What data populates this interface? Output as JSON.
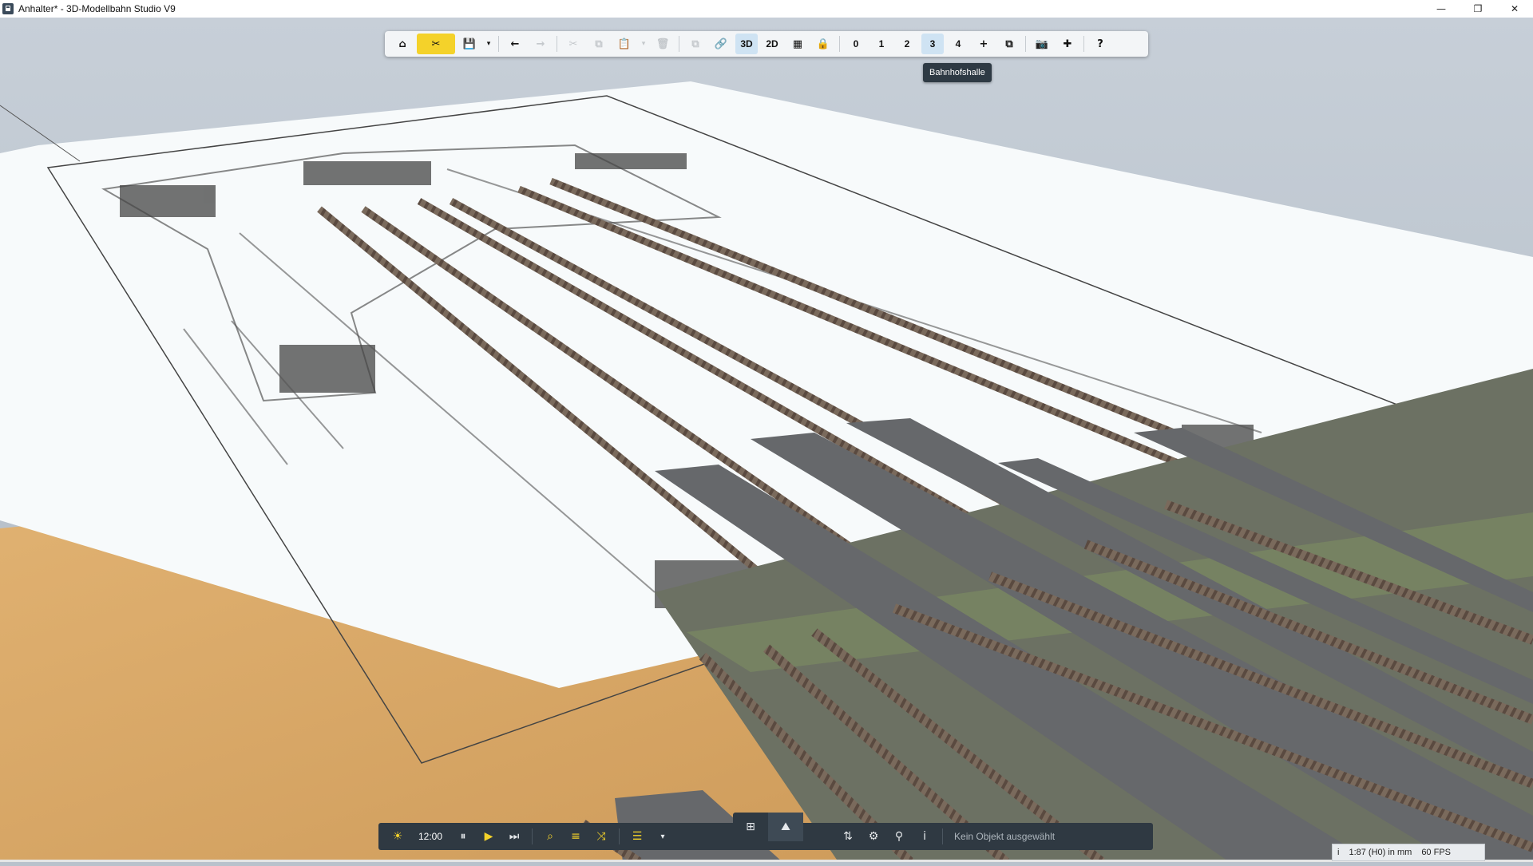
{
  "window": {
    "title": "Anhalter* - 3D-Modellbahn Studio V9",
    "minimize": "—",
    "restore": "❐",
    "close": "✕"
  },
  "toolbar": {
    "home": "⌂",
    "tools": "✂",
    "save": "💾",
    "save_dropdown": "▾",
    "undo": "←",
    "redo": "→",
    "cut": "✂",
    "copy": "⧉",
    "paste": "📋",
    "paste_dropdown": "▾",
    "delete": "🗑",
    "duplicate": "⧉",
    "link": "🔗",
    "view_3d": "3D",
    "view_2d": "2D",
    "grid": "▦",
    "lock": "🔒",
    "layers": [
      "0",
      "1",
      "2",
      "3",
      "4"
    ],
    "add": "+",
    "window": "⧉",
    "camera": "📷",
    "plugins": "✚",
    "help": "?"
  },
  "tooltip": {
    "text": "Bahnhofshalle"
  },
  "bottom": {
    "sun": "☀",
    "time": "12:00",
    "pause": "⏸",
    "play": "▶",
    "next": "⏭",
    "search": "⌕",
    "layers": "≡",
    "shuffle": "⤨",
    "list": "☰",
    "list_dropdown": "▾",
    "mode_grid": "⊞",
    "mode_terrain": "⛰",
    "sliders": "⇅",
    "settings": "⚙",
    "connect": "⚲",
    "info": "i",
    "status": "Kein Objekt ausgewählt"
  },
  "statusbar": {
    "info_icon": "i",
    "scale": "1:87 (H0) in mm",
    "fps": "60 FPS"
  },
  "colors": {
    "toolbar_bg": "#f3f5f7",
    "tools_active": "#f4d22a",
    "view_active": "#cfe3f3",
    "bottom_bg": "#2f3942",
    "sky": "#b9c2cc",
    "paper": "#f7fafb",
    "wood": "#d9a764",
    "platform": "#66686b"
  }
}
